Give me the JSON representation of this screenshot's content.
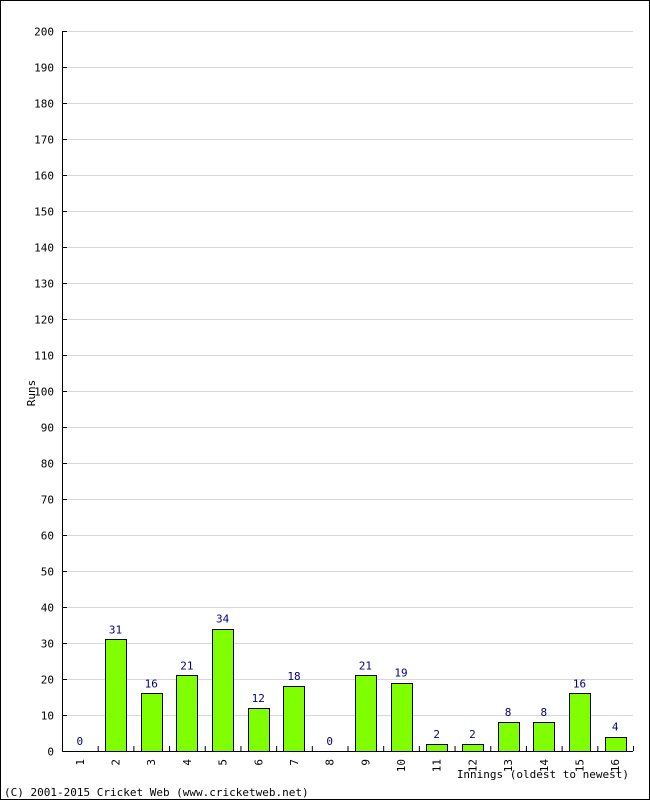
{
  "chart_data": {
    "type": "bar",
    "title": "",
    "xlabel": "Innings (oldest to newest)",
    "ylabel": "Runs",
    "ylim": [
      0,
      200
    ],
    "ytick_step": 10,
    "grid": true,
    "categories": [
      "1",
      "2",
      "3",
      "4",
      "5",
      "6",
      "7",
      "8",
      "9",
      "10",
      "11",
      "12",
      "13",
      "14",
      "15",
      "16"
    ],
    "values": [
      0,
      31,
      16,
      21,
      34,
      12,
      18,
      0,
      21,
      19,
      2,
      2,
      8,
      8,
      16,
      4
    ],
    "bar_color": "#80ff00",
    "label_color": "#000080"
  },
  "footer": {
    "credit": "(C) 2001-2015 Cricket Web (www.cricketweb.net)"
  }
}
